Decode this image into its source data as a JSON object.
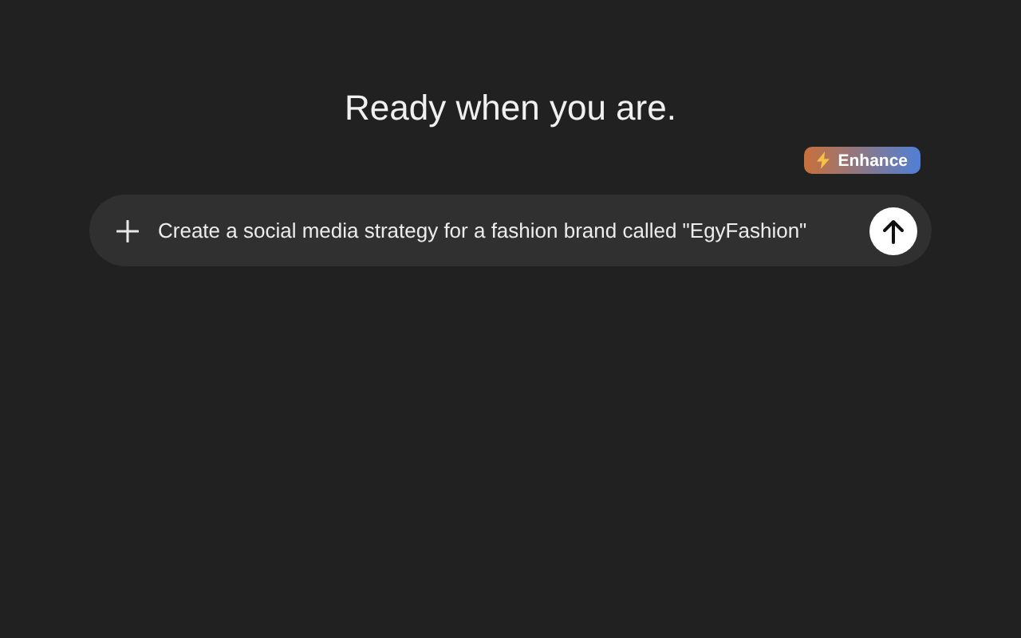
{
  "heading": "Ready when you are.",
  "enhance_button": {
    "label": "Enhance"
  },
  "prompt": {
    "value": "Create a social media strategy for a fashion brand called \"EgyFashion\""
  }
}
